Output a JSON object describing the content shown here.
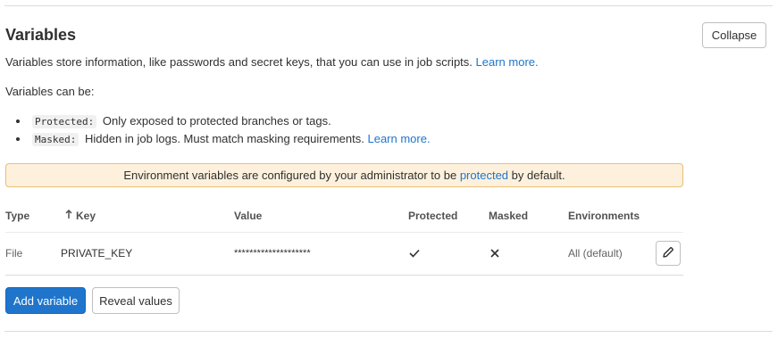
{
  "section": {
    "title": "Variables",
    "collapse_label": "Collapse",
    "description": "Variables store information, like passwords and secret keys, that you can use in job scripts.",
    "description_link": "Learn more.",
    "can_be_label": "Variables can be:",
    "bullets": [
      {
        "code": "Protected:",
        "text": "Only exposed to protected branches or tags."
      },
      {
        "code": "Masked:",
        "text": "Hidden in job logs. Must match masking requirements.",
        "link": "Learn more."
      }
    ]
  },
  "alert": {
    "text_before": "Environment variables are configured by your administrator to be",
    "link": "protected",
    "text_after": "by default."
  },
  "table": {
    "headers": {
      "type": "Type",
      "key": "Key",
      "value": "Value",
      "protected": "Protected",
      "masked": "Masked",
      "environments": "Environments"
    },
    "rows": [
      {
        "type": "File",
        "key": "PRIVATE_KEY",
        "value": "********************",
        "protected_icon": "check-icon",
        "masked_icon": "close-icon",
        "environments": "All (default)"
      }
    ]
  },
  "actions": {
    "add_label": "Add variable",
    "reveal_label": "Reveal values"
  },
  "colors": {
    "link": "#1f75cb",
    "primary": "#1f75cb",
    "alert_bg": "#fdf1dd",
    "alert_border": "#e9be74"
  }
}
